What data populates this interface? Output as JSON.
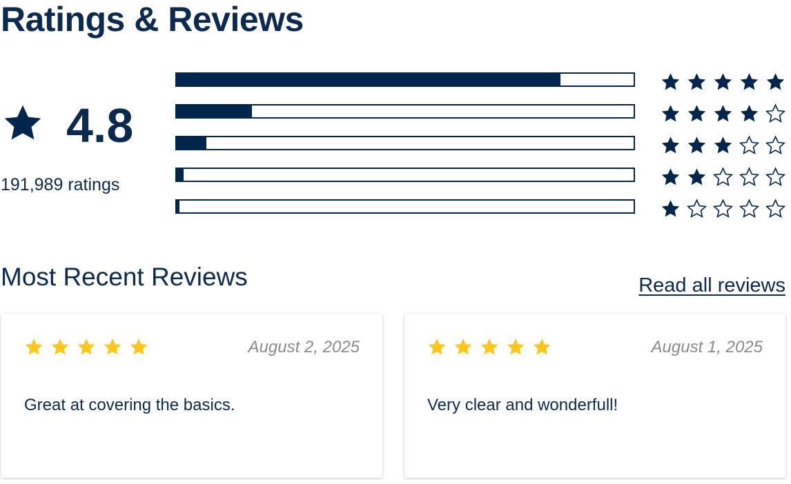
{
  "title": "Ratings & Reviews",
  "summary": {
    "average": "4.8",
    "count_text": "191,989 ratings",
    "icon": "star-icon"
  },
  "distribution": [
    {
      "stars": 5,
      "fraction": 0.84
    },
    {
      "stars": 4,
      "fraction": 0.165
    },
    {
      "stars": 3,
      "fraction": 0.065
    },
    {
      "stars": 2,
      "fraction": 0.015
    },
    {
      "stars": 1,
      "fraction": 0.006
    }
  ],
  "colors": {
    "navy": "#00264d",
    "gold": "#ffc61a",
    "date_gray": "#8a8a8a"
  },
  "recent": {
    "title": "Most Recent Reviews",
    "read_all_label": "Read all reviews"
  },
  "reviews": [
    {
      "rating": 5,
      "date": "August 2, 2025",
      "text": "Great at covering the basics."
    },
    {
      "rating": 5,
      "date": "August 1, 2025",
      "text": "Very clear and wonderfull!"
    }
  ]
}
